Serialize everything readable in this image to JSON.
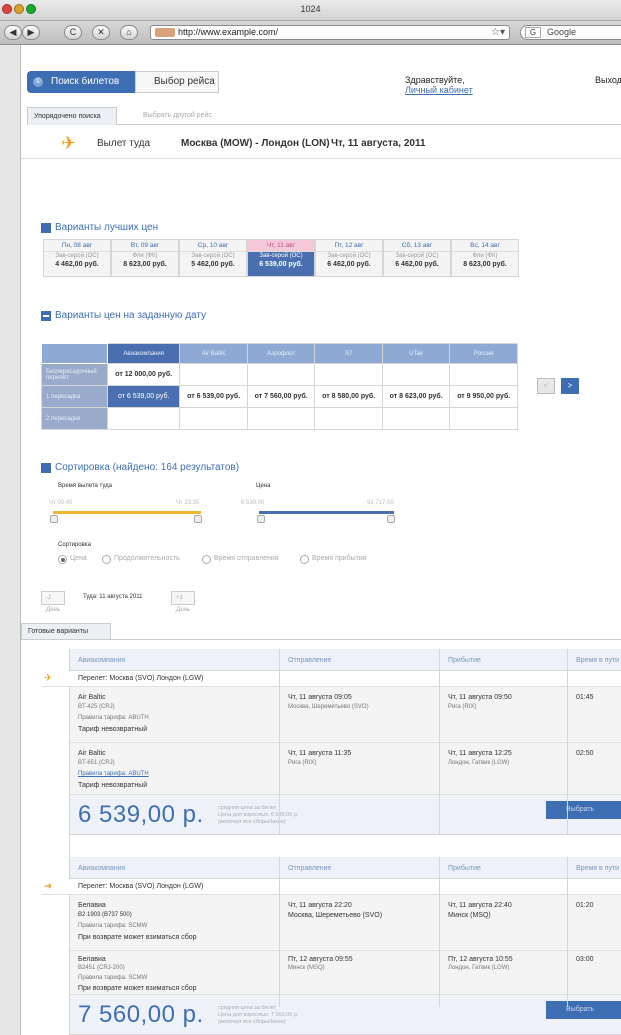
{
  "browser": {
    "window_title": "1024",
    "url": "http://www.example.com/",
    "search_engine": "Google",
    "nav_buttons": [
      "◀",
      "▶",
      "C",
      "✕",
      "⌂"
    ]
  },
  "steps": {
    "active_number": "①",
    "active_label": "Поиск билетов",
    "next_label": "Выбор рейса"
  },
  "user": {
    "greeting": "Здравствуйте,",
    "cabinet_link": "Личный кабинет",
    "exit_label": "Выход"
  },
  "tabs": {
    "active": "Упорядочено поиска",
    "inactive": "Выбрать другой рейс"
  },
  "flight": {
    "direction": "Вылет туда",
    "route": "Москва (MOW) - Лондон (LON)",
    "date": "Чт, 11 августа, 2011"
  },
  "best_prices": {
    "title": "Варианты лучших цен",
    "days": [
      {
        "date": "Пн, 08 авг",
        "sub": "Зав-серой (OC)",
        "price": "4 462,00 руб."
      },
      {
        "date": "Вт, 09 авг",
        "sub": "Фли (ФК)",
        "price": "8 623,00 руб."
      },
      {
        "date": "Ср, 10 авг",
        "sub": "Зав-серой (OC)",
        "price": "5 462,00 руб."
      },
      {
        "date": "Чт, 11 авг",
        "sub": "Зав-серой (OC)",
        "price": "6 539,00 руб."
      },
      {
        "date": "Пт, 12 авг",
        "sub": "Зав-серой (OC)",
        "price": "6 462,00 руб."
      },
      {
        "date": "Сб, 13 авг",
        "sub": "Зав-серой (OC)",
        "price": "6 462,00 руб."
      },
      {
        "date": "Вс, 14 авг",
        "sub": "Фли (ФК)",
        "price": "8 623,00 руб."
      }
    ]
  },
  "date_grid": {
    "title": "Варианты цен на заданную дату",
    "airlines": [
      "Авиакомпания",
      "Air Baltic",
      "Аэрофлот",
      "S7",
      "UTair",
      "Россия"
    ],
    "rows": [
      {
        "label": "Беспересадочный перелёт",
        "cells": [
          "от 12 000,00 руб.",
          "",
          "",
          "",
          "",
          ""
        ]
      },
      {
        "label": "1 пересадка",
        "cells": [
          "от 6 539,00 руб.",
          "от 6 539,00 руб.",
          "от 7 560,00 руб.",
          "от 8 580,00 руб.",
          "от 8 623,00 руб.",
          "от 9 950,00 руб."
        ]
      },
      {
        "label": "2 пересадки",
        "cells": [
          "",
          "",
          "",
          "",
          "",
          ""
        ]
      }
    ],
    "prev": "<",
    "next": ">"
  },
  "sort": {
    "title": "Сортировка (найдено: 164 результатов)",
    "dep_label": "Время вылета туда",
    "dep_from": "Чт 00:45",
    "dep_to": "Чт 23:35",
    "price_label": "Цена",
    "price_from": "6 539,00",
    "price_to": "91 717,00",
    "sort_label": "Сортировка",
    "options": [
      "Цена",
      "Продолжительность",
      "Время отправления",
      "Время прибытия"
    ]
  },
  "day_nav": {
    "prev": "-1 День",
    "current": "Туда: 11 августа 2011",
    "next": "+1 День"
  },
  "ready": {
    "tab_label": "Готовые варианты",
    "columns": [
      "Авиакомпания",
      "Отправление",
      "Прибытие",
      "Время в пути"
    ],
    "offers": [
      {
        "route": "Перелет: Москва (SVO) Лондон (LGW)",
        "segments": [
          {
            "airline": "Air Baltic",
            "flight": "BT-425 (CRJ)",
            "fare_note": "Правила тарифа: ABUTH",
            "fare": "Тариф невозвратный",
            "dep": "Чт, 11 августа 09:05",
            "dep_place": "Москва, Шереметьево (SVO)",
            "arr": "Чт, 11 августа 09:50",
            "arr_place": "Рига (RIX)",
            "dur": "01:45"
          },
          {
            "airline": "Air Baltic",
            "flight": "BT-651 (CRJ)",
            "fare_note": "Правила тарифа: ABUTH",
            "fare": "Тариф невозвратный",
            "dep": "Чт, 11 августа 11:35",
            "dep_place": "Рига (RIX)",
            "arr": "Чт, 11 августа 12:25",
            "arr_place": "Лондон, Гатвик (LGW)",
            "dur": "02:50"
          }
        ],
        "price": "6 539,00 р.",
        "note": [
          "средняя цена за билет",
          "Цена для взрослых: 6 539,00 р.",
          "(включая все сборы/taxes)"
        ],
        "buy": "Выбрать"
      },
      {
        "route": "Перелет: Москва (SVO) Лондон (LGW)",
        "segments": [
          {
            "airline": "Белавиа",
            "flight": "B2 1903 (B737 500)",
            "fare_note": "Правила тарифа: SCMW",
            "fare": "При возврате может взиматься сбор",
            "dep": "Чт, 11 августа 22:20",
            "dep_place": "Москва, Шереметьево (SVO)",
            "arr": "Чт, 11 августа 22:40",
            "arr_place": "Минск (MSQ)",
            "dur": "01:20"
          },
          {
            "airline": "Белавиа",
            "flight": "B2451 (CRJ-200)",
            "fare_note": "Правила тарифа: SCMW",
            "fare": "При возврате может взиматься сбор",
            "dep": "Пт, 12 августа 09:55",
            "dep_place": "Минск (MSQ)",
            "arr": "Пт, 12 августа 10:55",
            "arr_place": "Лондон, Гатвик (LGW)",
            "dur": "03:00"
          }
        ],
        "price": "7 560,00 р.",
        "note": [
          "средняя цена за билет",
          "Цена для взрослых: 7 560,00 р.",
          "(включая все сборы/taxes)"
        ],
        "buy": "Выбрать"
      }
    ]
  }
}
